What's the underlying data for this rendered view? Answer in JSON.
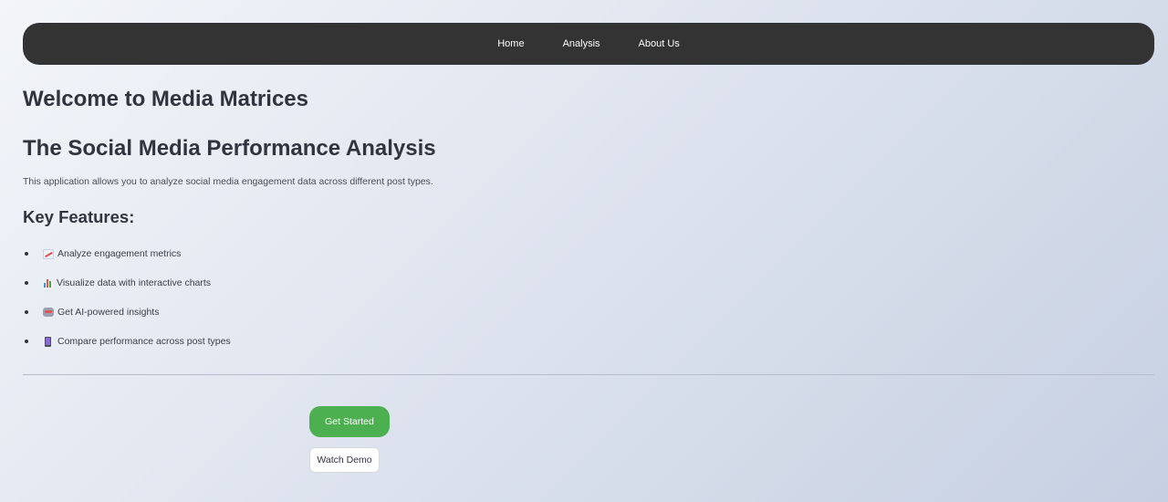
{
  "nav": {
    "items": [
      {
        "label": "Home"
      },
      {
        "label": "Analysis"
      },
      {
        "label": "About Us"
      }
    ]
  },
  "main": {
    "title": "Welcome to Media Matrices",
    "subtitle": "The Social Media Performance Analysis",
    "description": "This application allows you to analyze social media engagement data across different post types.",
    "features_heading": "Key Features:",
    "features": [
      {
        "icon": "chart-increasing-icon",
        "label": "Analyze engagement metrics"
      },
      {
        "icon": "bar-chart-icon",
        "label": "Visualize data with interactive charts"
      },
      {
        "icon": "robot-icon",
        "label": "Get AI-powered insights"
      },
      {
        "icon": "mobile-phone-icon",
        "label": "Compare performance across post types"
      }
    ]
  },
  "actions": {
    "primary_label": "Get Started",
    "secondary_label": "Watch Demo"
  },
  "colors": {
    "navbar": "#333333",
    "primary_button": "#4caf50",
    "text": "#31333f"
  }
}
